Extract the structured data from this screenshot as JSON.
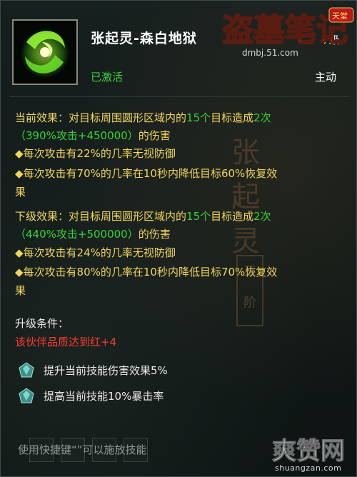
{
  "header": {
    "title": "张起灵-森白地狱",
    "level_tail": "7级",
    "logo_text": "盗墓笔记",
    "logo_badge": "天堂",
    "logo_url": "dmbj.51.com",
    "status": "已激活",
    "skill_type": "主动"
  },
  "current_effect": {
    "label": "当前效果：",
    "desc1": "对目标周围圆形区域内的",
    "target_count": "15个",
    "desc2": "目标造成",
    "times": "2次",
    "formula": "（390%攻击+450000）",
    "damage": "的伤害",
    "bullet1": "◆每次攻击有22%的几率无视防御",
    "bullet2_line1": "◆每次攻击有70%的几率在10秒内降低目标60%恢复效",
    "bullet2_line2": "果"
  },
  "next_effect": {
    "label": "下级效果：",
    "desc1": "对目标周围圆形区域内的",
    "target_count": "15个",
    "desc2": "目标造成",
    "times": "2次",
    "formula": "（440%攻击+500000）",
    "damage": "的伤害",
    "bullet1": "◆每次攻击有24%的几率无视防御",
    "bullet2_line1": "◆每次攻击有80%的几率在10秒内降低目标70%恢复效",
    "bullet2_line2": "果"
  },
  "upgrade": {
    "label": "升级条件：",
    "requirement": "该伙伴品质达到红+4",
    "items": [
      {
        "icon": "crystal-icon",
        "text": "提升当前技能伤害效果5%"
      },
      {
        "icon": "crystal-icon",
        "text": "提高当前技能10%暴击率"
      }
    ]
  },
  "footer": {
    "hint": "使用快捷键“”可以施放技能",
    "site_logo": "爽赞网",
    "site_url": "shuangzan.com"
  },
  "watermark": {
    "name": "张起灵",
    "seal": "三阶"
  },
  "colors": {
    "yellow": "#f0d55c",
    "green": "#35d335",
    "red": "#ff3b2e",
    "white": "#e9e9e9"
  }
}
